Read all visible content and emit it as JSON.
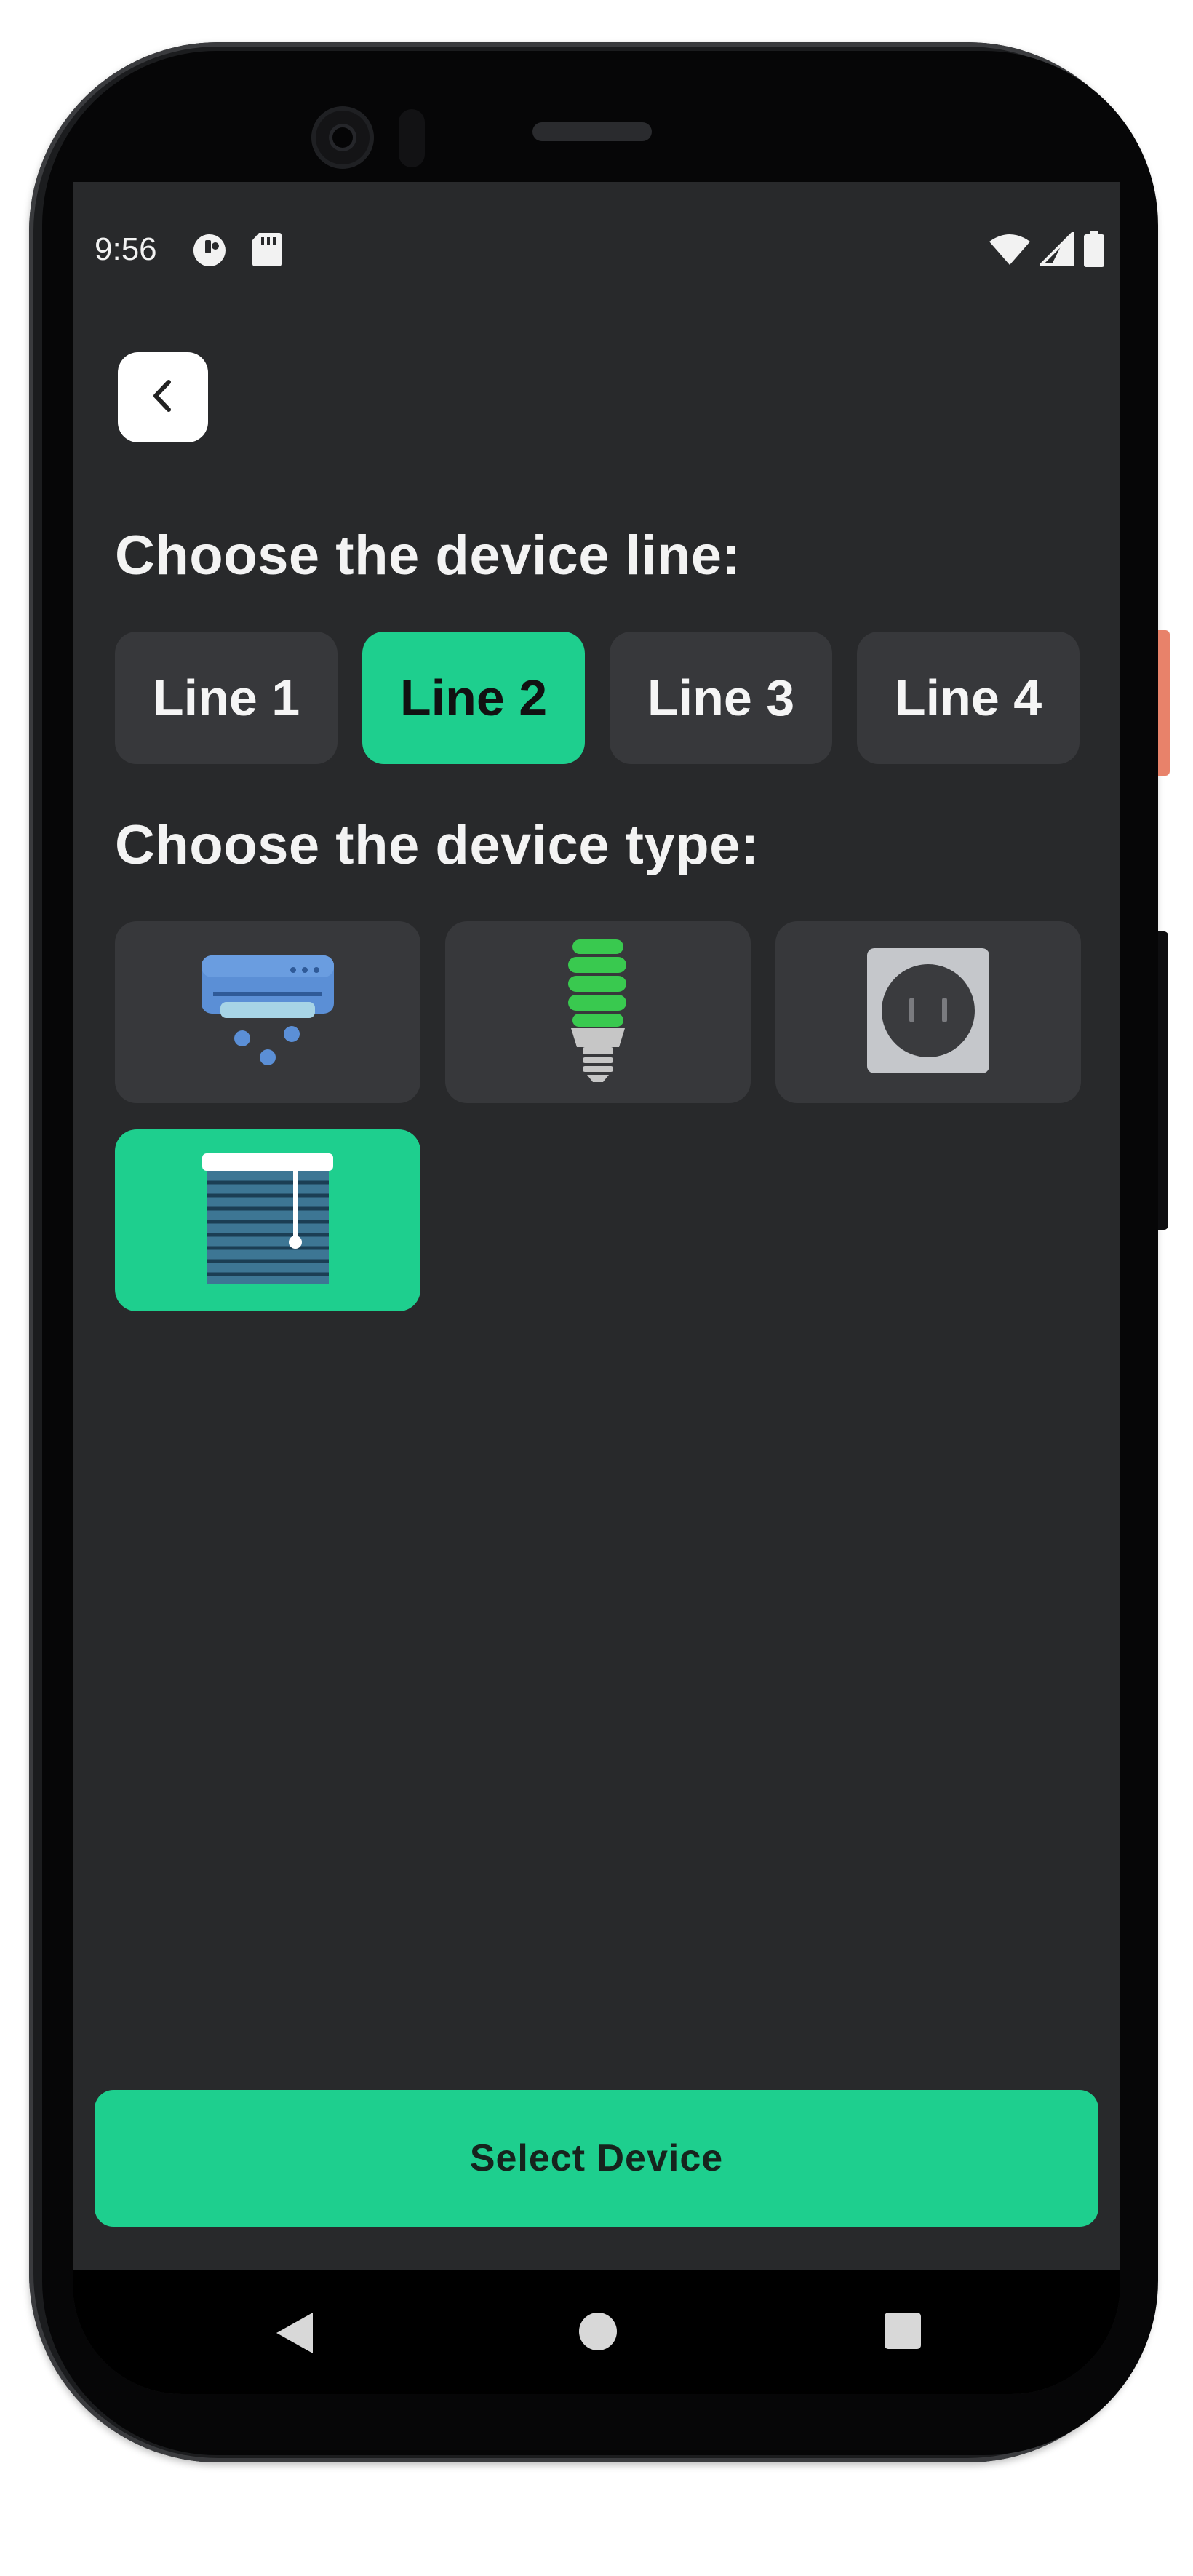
{
  "status_bar": {
    "time": "9:56",
    "left_icons": [
      "data-saver-icon",
      "sd-card-icon"
    ],
    "right_icons": [
      "wifi-icon",
      "cell-signal-icon",
      "battery-icon"
    ]
  },
  "back_button": {
    "icon": "chevron-left-icon"
  },
  "line_section": {
    "heading": "Choose the device line:",
    "options": [
      "Line 1",
      "Line 2",
      "Line 3",
      "Line 4"
    ],
    "selected": "Line 2"
  },
  "type_section": {
    "heading": "Choose the device type:",
    "options": [
      {
        "icon": "air-conditioner-icon",
        "selected": false
      },
      {
        "icon": "light-bulb-icon",
        "selected": false
      },
      {
        "icon": "power-socket-icon",
        "selected": false
      },
      {
        "icon": "window-blinds-icon",
        "selected": true
      }
    ]
  },
  "primary_action": {
    "label": "Select Device"
  },
  "nav_bar": {
    "icons": [
      "nav-back-icon",
      "nav-home-icon",
      "nav-recents-icon"
    ]
  },
  "colors": {
    "accent": "#1ecf8e",
    "background": "#28292b",
    "card": "#37383b"
  }
}
